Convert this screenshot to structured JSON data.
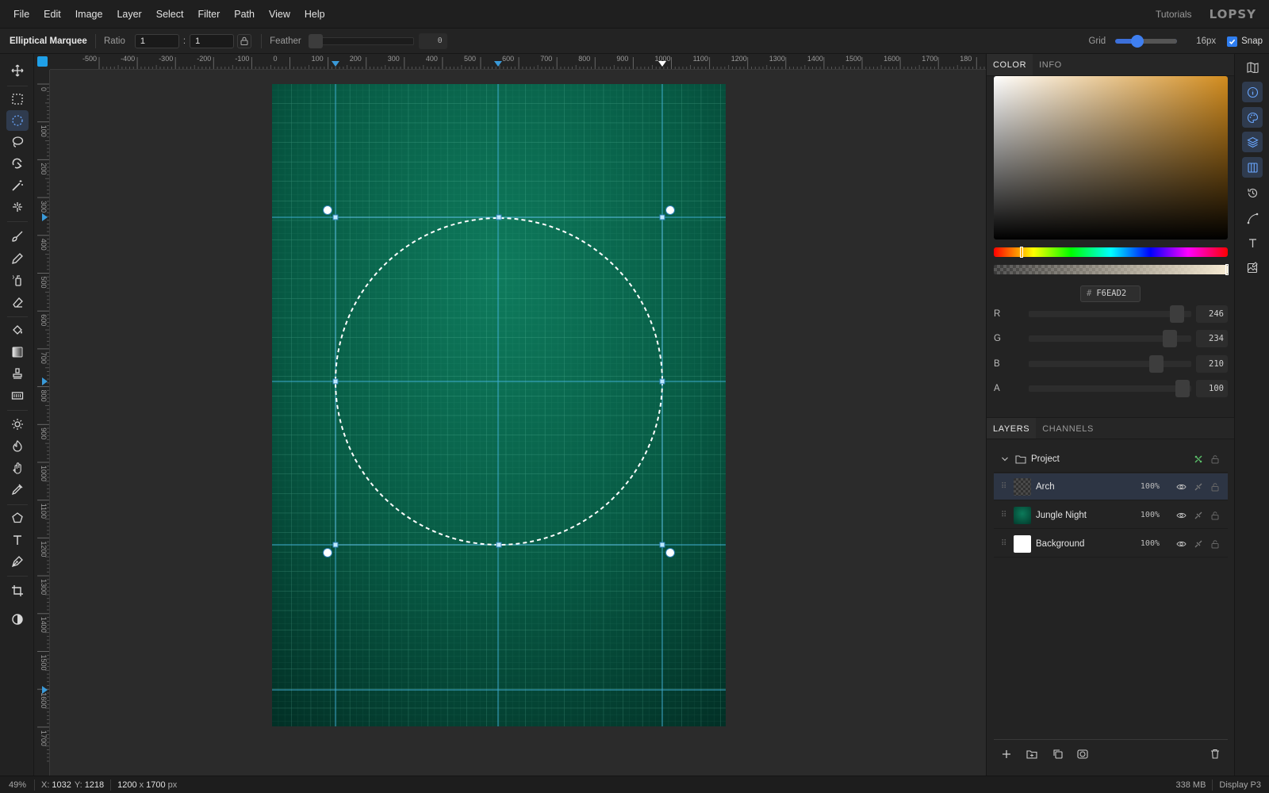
{
  "menu": {
    "items": [
      "File",
      "Edit",
      "Image",
      "Layer",
      "Select",
      "Filter",
      "Path",
      "View",
      "Help"
    ],
    "tutorials": "Tutorials",
    "logo": "LOPSY"
  },
  "options": {
    "tool_name": "Elliptical Marquee",
    "ratio_label": "Ratio",
    "ratio_w": "1",
    "ratio_sep": ":",
    "ratio_h": "1",
    "feather_label": "Feather",
    "feather_value": "0",
    "feather_level": 0,
    "grid_label": "Grid",
    "grid_size": "16px",
    "snap_label": "Snap",
    "snap_checked": true
  },
  "rulers": {
    "h_labels": [
      "-500",
      "-400",
      "-300",
      "-200",
      "-100",
      "0",
      "100",
      "200",
      "300",
      "400",
      "500",
      "600",
      "700",
      "800",
      "900",
      "1000",
      "1100",
      "1200",
      "1300",
      "1400",
      "1500",
      "1600",
      "1700",
      "180"
    ],
    "v_labels": [
      "0",
      "100",
      "200",
      "300",
      "400",
      "500",
      "600",
      "700",
      "800",
      "900",
      "1000",
      "1100",
      "1200",
      "1300",
      "1400",
      "1500",
      "1600",
      "1700"
    ]
  },
  "tools": [
    "move-icon",
    "rect-marquee-icon",
    "elliptical-marquee-icon",
    "lasso-icon",
    "quick-select-icon",
    "magic-wand-icon",
    "healing-icon",
    "brush-icon",
    "pencil-icon",
    "spray-icon",
    "eraser-icon",
    "bucket-icon",
    "gradient-icon",
    "stamp-icon",
    "pattern-icon",
    "dodge-icon",
    "burn-icon",
    "smudge-icon",
    "eyedropper-icon",
    "shape-icon",
    "text-icon",
    "pen-icon",
    "crop-icon",
    "contrast-icon"
  ],
  "color_panel": {
    "tabs": [
      "COLOR",
      "INFO"
    ],
    "hex_prefix": "#",
    "hex": "F6EAD2",
    "channels": [
      {
        "label": "R",
        "value": "246"
      },
      {
        "label": "G",
        "value": "234"
      },
      {
        "label": "B",
        "value": "210"
      },
      {
        "label": "A",
        "value": "100"
      }
    ],
    "accent": "#f6ead2"
  },
  "layers_panel": {
    "tabs": [
      "LAYERS",
      "CHANNELS"
    ],
    "group": {
      "name": "Project"
    },
    "layers": [
      {
        "name": "Arch",
        "opacity": "100%",
        "selected": true
      },
      {
        "name": "Jungle Night",
        "opacity": "100%",
        "selected": false
      },
      {
        "name": "Background",
        "opacity": "100%",
        "selected": false
      }
    ]
  },
  "status": {
    "zoom": "49%",
    "x_label": "X:",
    "x": "1032",
    "y_label": "Y:",
    "y": "1218",
    "doc_w": "1200",
    "doc_x": "x",
    "doc_h": "1700",
    "doc_unit": "px",
    "memory": "338 MB",
    "profile": "Display P3"
  }
}
